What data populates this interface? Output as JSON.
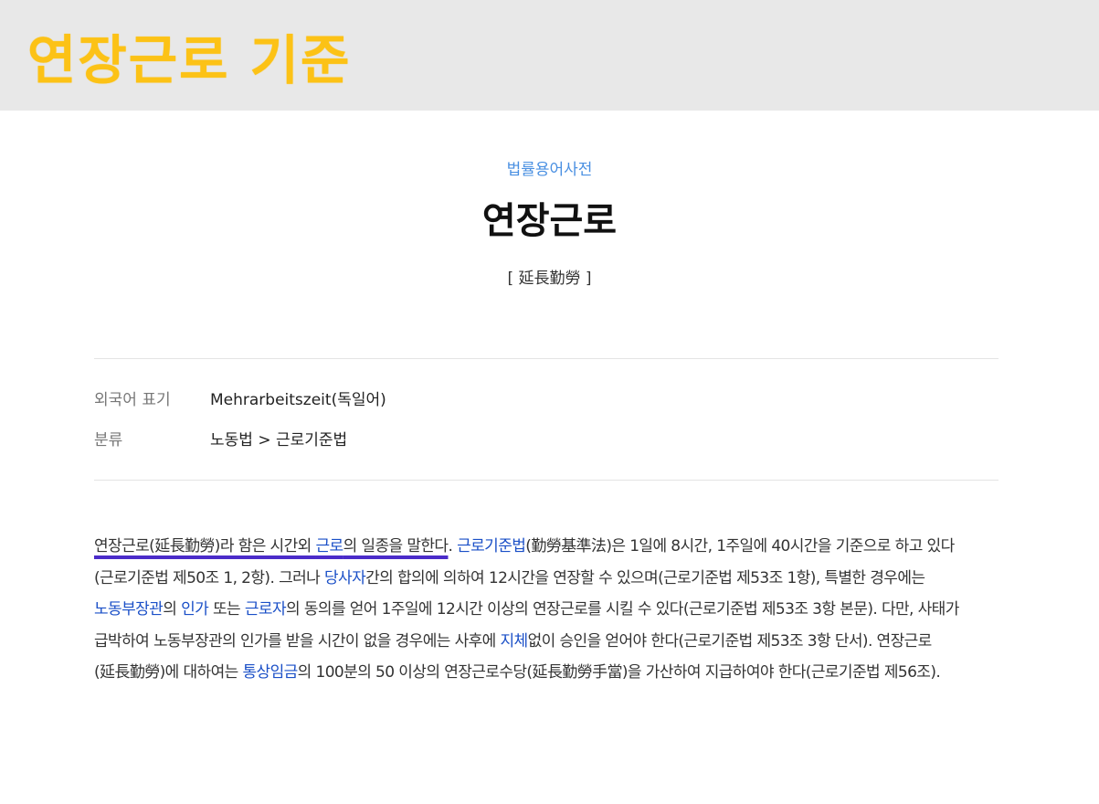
{
  "banner": {
    "title": "연장근로 기준"
  },
  "entry": {
    "source": "법률용어사전",
    "headword": "연장근로",
    "hanja": "[ 延長勤勞 ]"
  },
  "meta": {
    "foreign_label": "외국어 표기",
    "foreign_value": "Mehrarbeitszeit(독일어)",
    "category_label": "분류",
    "category_value": "노동법 > 근로기준법"
  },
  "body": {
    "s01": "연장근로(延長勤勞)라 함은 시간외 ",
    "l01": "근로",
    "s02": "의 일종을 말한다",
    "s03": ". ",
    "l02": "근로기준법",
    "s04": "(勤勞基準法)은 1일에 8시간, 1주일에 40시간을 기준으로 하고 있다(근로기준법 제50조 1, 2항). 그러나 ",
    "l03": "당사자",
    "s05": "간의 합의에 의하여 12시간을 연장할 수 있으며(근로기준법 제53조 1항), 특별한 경우에는 ",
    "l04": "노동부장관",
    "s06": "의 ",
    "l05": "인가",
    "s07": " 또는 ",
    "l06": "근로자",
    "s08": "의 동의를 얻어 1주일에 12시간 이상의 연장근로를 시킬 수 있다(근로기준법 제53조 3항 본문). 다만, 사태가 급박하여 노동부장관의 인가를 받을 시간이 없을 경우에는 사후에 ",
    "l07": "지체",
    "s09": "없이 승인을 얻어야 한다(근로기준법 제53조 3항 단서). 연장근로(延長勤勞)에 대하여는 ",
    "l08": "통상임금",
    "s10": "의 100분의 50 이상의 연장근로수당(延長勤勞手當)을 가산하여 지급하여야 한다(근로기준법 제56조)."
  },
  "colors": {
    "banner_text": "#fcc216",
    "link": "#1a4fc7",
    "source": "#4a90e2",
    "underline": "#4b2cc9"
  }
}
